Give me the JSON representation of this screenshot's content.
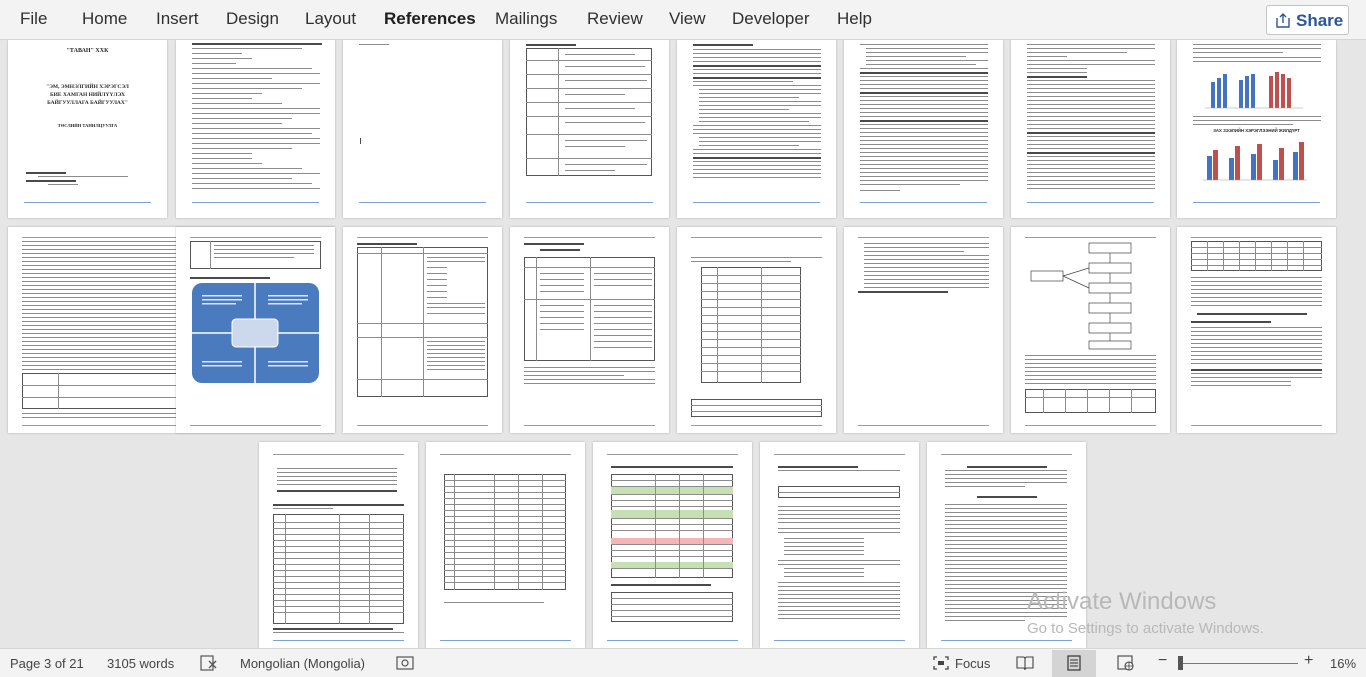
{
  "menu": {
    "tabs": [
      {
        "label": "File"
      },
      {
        "label": "Home"
      },
      {
        "label": "Insert"
      },
      {
        "label": "Design"
      },
      {
        "label": "Layout"
      },
      {
        "label": "References"
      },
      {
        "label": "Mailings"
      },
      {
        "label": "Review"
      },
      {
        "label": "View"
      },
      {
        "label": "Developer"
      },
      {
        "label": "Help"
      }
    ],
    "active_tab": "References",
    "share_label": "Share",
    "share_icon": "share-icon"
  },
  "document": {
    "cover": {
      "org": "\"ТАВАН\" ХХК",
      "title_line1": "\"ЭМ, ЭМНЭЛГИЙН ХЭРЭГСЭЛ",
      "title_line2": "БИЕ ХАМГАН НИЙЛҮҮЛЭХ",
      "title_line3": "БАЙГУУЛЛАГА БАЙГУУЛАХ\"",
      "subtitle": "ТӨСЛИЙН ТАНИЛЦУУЛГА"
    },
    "chart_caption": "ЗАХ ЗЭЭЛИЙН ХЭРЭГЛЭЭНИЙ ЖИЛДҮРТ"
  },
  "status": {
    "page_info": "Page 3 of 21",
    "words": "3105 words",
    "language": "Mongolian (Mongolia)",
    "focus_label": "Focus",
    "zoom_minus": "−",
    "zoom_plus": "+",
    "zoom_level": "16%"
  },
  "watermark": {
    "line1": "Activate Windows",
    "line2": "Go to Settings to activate Windows."
  },
  "colors": {
    "accent": "#2b579a",
    "ribbon_bg": "#f3f3f3",
    "canvas_bg": "#e6e6e6"
  }
}
